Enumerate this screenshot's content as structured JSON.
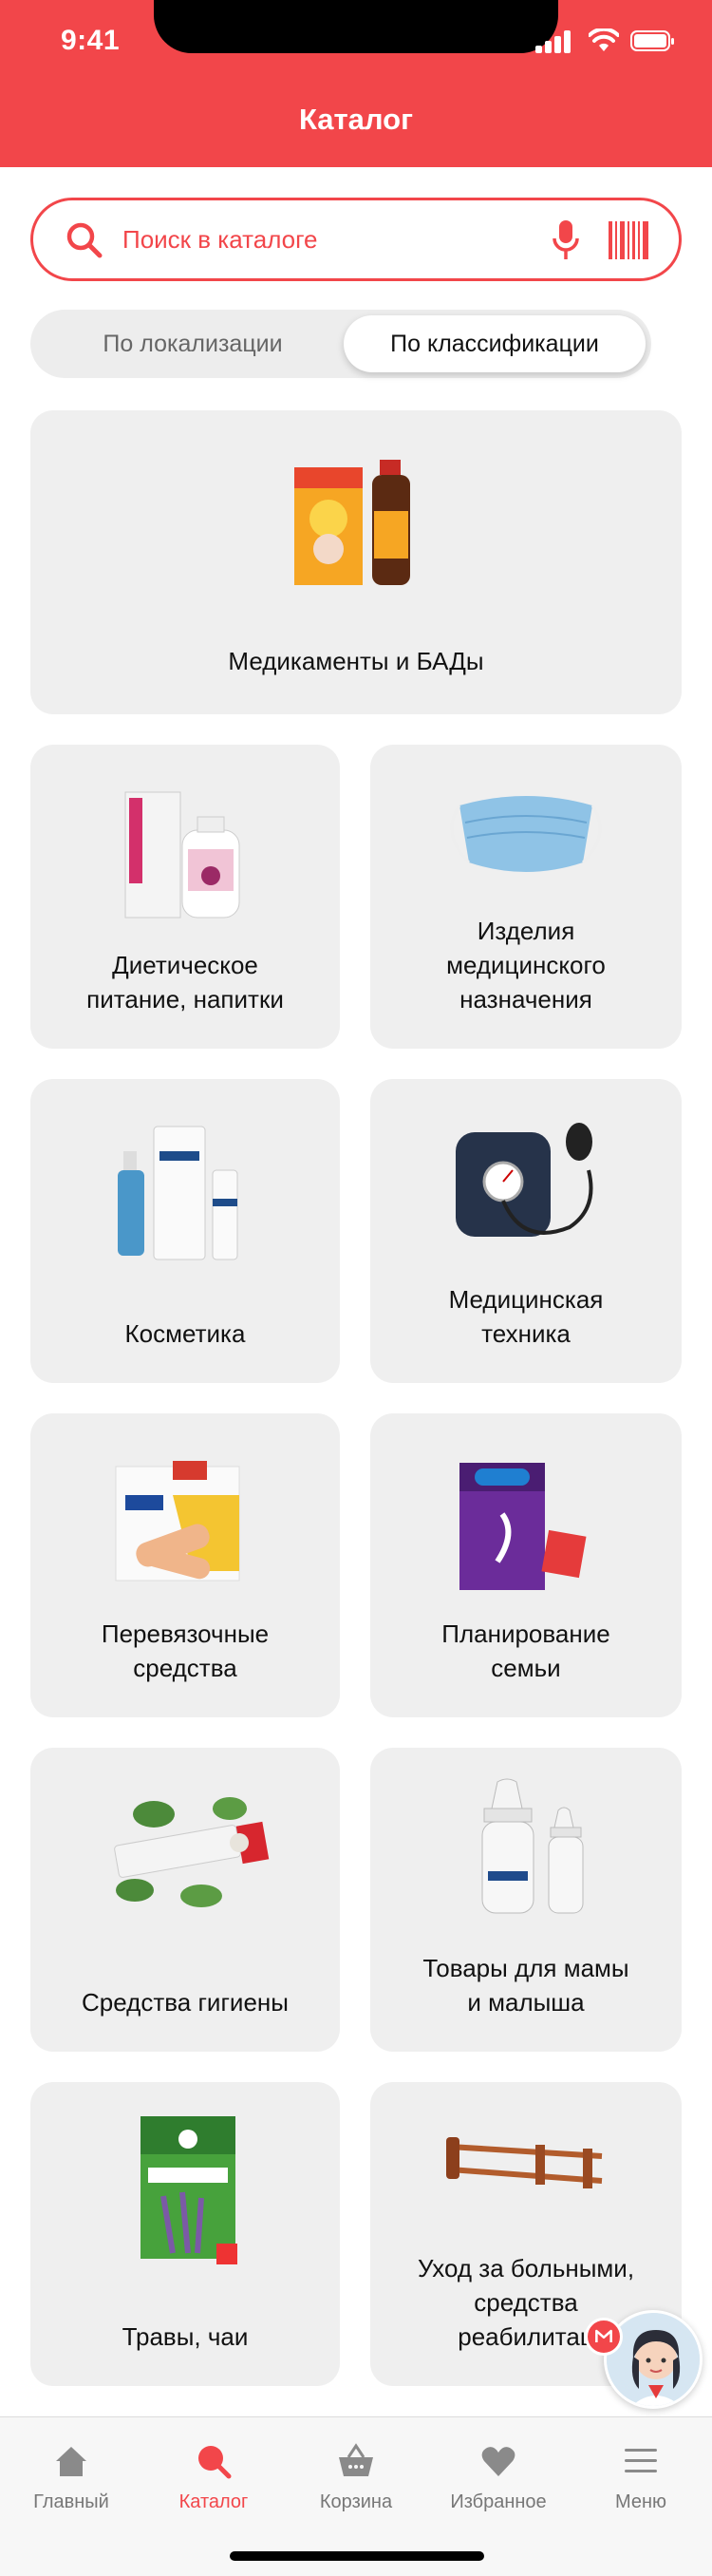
{
  "status_bar": {
    "time": "9:41"
  },
  "header": {
    "title": "Каталог"
  },
  "search": {
    "placeholder": "Поиск в каталоге",
    "icon": "search-icon",
    "mic_icon": "microphone-icon",
    "barcode_icon": "barcode-icon"
  },
  "tabs": {
    "left": "По локализации",
    "right": "По классификации",
    "active": "right"
  },
  "categories": [
    {
      "label": "Медикаменты и БАДы",
      "icon": "medicine-product-image"
    },
    {
      "label_lines": [
        "Диетическое",
        "питание, напитки"
      ],
      "icon": "diet-drink-product-image"
    },
    {
      "label_lines": [
        "Изделия",
        "медицинского",
        "назначения"
      ],
      "icon": "face-mask-image"
    },
    {
      "label": "Косметика",
      "icon": "cosmetics-image"
    },
    {
      "label_lines": [
        "Медицинская",
        "техника"
      ],
      "icon": "blood-pressure-monitor-image"
    },
    {
      "label_lines": [
        "Перевязочные",
        "средства"
      ],
      "icon": "bandage-image"
    },
    {
      "label_lines": [
        "Планирование",
        "семьи"
      ],
      "icon": "condom-box-image"
    },
    {
      "label": "Средства гигиены",
      "icon": "toothpaste-image"
    },
    {
      "label_lines": [
        "Товары для мамы",
        "и малыша"
      ],
      "icon": "baby-bottle-image"
    },
    {
      "label": "Травы, чаи",
      "icon": "herbal-tea-image"
    },
    {
      "label_lines": [
        "Уход за больными,",
        "средства",
        "реабилитац"
      ],
      "icon": "crutches-image"
    }
  ],
  "bottom_nav": [
    {
      "label": "Главный",
      "icon": "home-icon"
    },
    {
      "label": "Каталог",
      "icon": "catalog-icon",
      "active": true
    },
    {
      "label": "Корзина",
      "icon": "basket-icon"
    },
    {
      "label": "Избранное",
      "icon": "heart-icon"
    },
    {
      "label": "Меню",
      "icon": "menu-icon"
    }
  ],
  "colors": {
    "accent": "#f2464a",
    "card_bg": "#efefef",
    "nav_inactive": "#777777"
  }
}
